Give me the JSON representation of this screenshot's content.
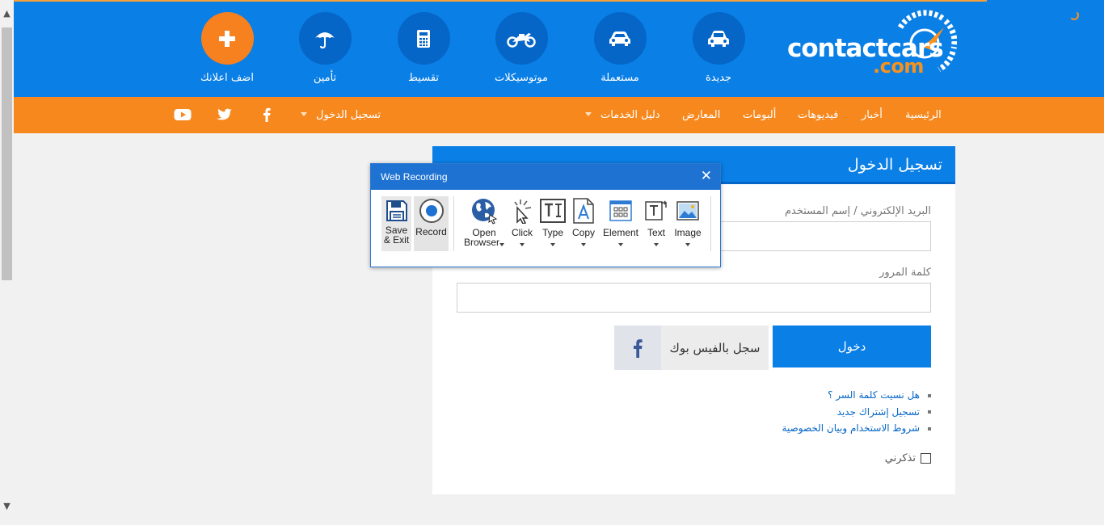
{
  "scrollbar": {
    "up": "▲",
    "down": "▼"
  },
  "header": {
    "logo_main": "contactcars",
    "logo_com": ".com",
    "categories": [
      {
        "label": "جديدة",
        "icon": "new-car-icon"
      },
      {
        "label": "مستعملة",
        "icon": "used-car-icon"
      },
      {
        "label": "موتوسيكلات",
        "icon": "motorcycle-icon"
      },
      {
        "label": "تقسيط",
        "icon": "calculator-icon"
      },
      {
        "label": "تأمين",
        "icon": "umbrella-icon"
      },
      {
        "label": "اضف اعلانك",
        "icon": "plus-icon"
      }
    ]
  },
  "nav": {
    "items": [
      "الرئيسية",
      "أخبار",
      "فيديوهات",
      "ألبومات",
      "المعارض",
      "دليل الخدمات"
    ],
    "login": "تسجيل الدخول",
    "social": [
      "facebook-icon",
      "twitter-icon",
      "youtube-icon"
    ]
  },
  "login": {
    "title": "تسجيل الدخول",
    "email_label": "البريد الإلكتروني / إسم المستخدم",
    "password_label": "كلمة المرور",
    "submit_label": "دخول",
    "facebook_label": "سجل بالفيس بوك",
    "links": [
      "هل نسيت كلمة السر ؟",
      "تسجيل إشتراك جديد",
      "شروط الاستخدام وبيان الخصوصية"
    ],
    "remember_label": "تذكرني"
  },
  "recorder": {
    "title": "Web Recording",
    "close": "✕",
    "tools": {
      "save_l1": "Save",
      "save_l2": "& Exit",
      "record": "Record",
      "open_l1": "Open",
      "open_l2": "Browser",
      "click": "Click",
      "type": "Type",
      "copy": "Copy",
      "element": "Element",
      "text": "Text",
      "image": "Image"
    }
  },
  "colors": {
    "brand_blue": "#0a7fe6",
    "brand_orange": "#f7881e",
    "dark_blue": "#0566c7"
  }
}
